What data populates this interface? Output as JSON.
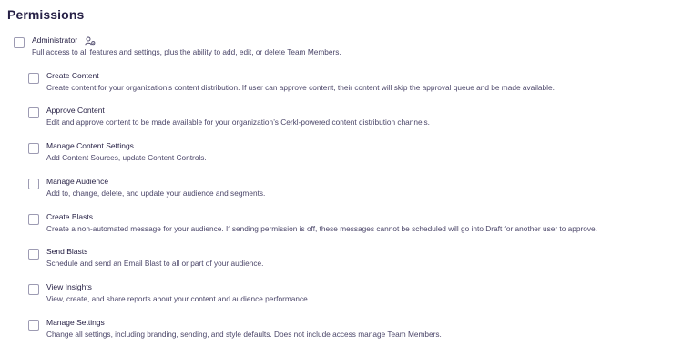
{
  "page_title": "Permissions",
  "admin": {
    "label": "Administrator",
    "icon": "user-gear-icon",
    "description": "Full access to all features and settings, plus the ability to add, edit, or delete Team Members."
  },
  "permissions": [
    {
      "label": "Create Content",
      "description": "Create content for your organization’s content distribution. If user can approve content, their content will skip the approval queue and be made available."
    },
    {
      "label": "Approve Content",
      "description": "Edit and approve content to be made available for your organization’s Cerkl-powered content distribution channels."
    },
    {
      "label": "Manage Content Settings",
      "description": "Add Content Sources, update Content Controls."
    },
    {
      "label": "Manage Audience",
      "description": "Add to, change, delete, and update your audience and segments."
    },
    {
      "label": "Create Blasts",
      "description": "Create a non-automated message for your audience. If sending permission is off, these messages cannot be scheduled will go into Draft for another user to approve."
    },
    {
      "label": "Send Blasts",
      "description": "Schedule and send an Email Blast to all or part of your audience."
    },
    {
      "label": "View Insights",
      "description": "View, create, and share reports about your content and audience performance."
    },
    {
      "label": "Manage Settings",
      "description": "Change all settings, including branding, sending, and style defaults. Does not include access manage Team Members."
    }
  ]
}
